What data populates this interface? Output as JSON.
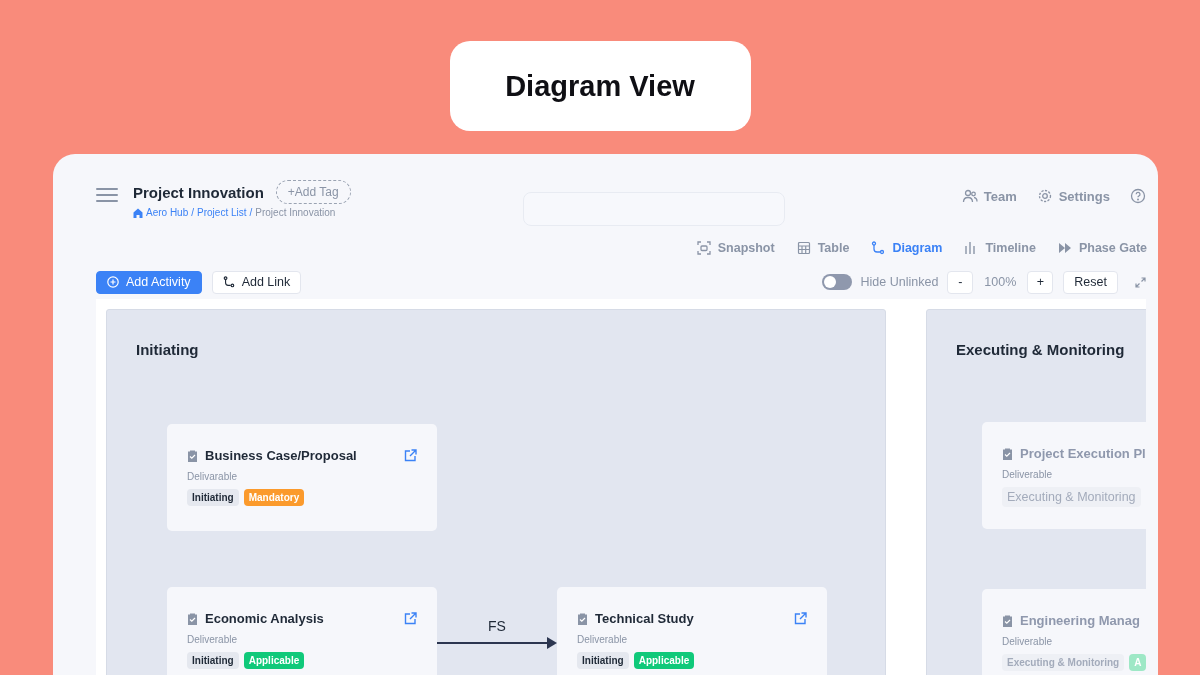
{
  "banner": {
    "title": "Diagram View"
  },
  "header": {
    "project_title": "Project Innovation",
    "add_tag": "+Add Tag",
    "breadcrumb": [
      {
        "label": "Aero Hub",
        "kind": "link"
      },
      {
        "label": "/",
        "kind": "sep"
      },
      {
        "label": "Project List",
        "kind": "link"
      },
      {
        "label": "/",
        "kind": "sep"
      },
      {
        "label": "Project Innovation",
        "kind": "current"
      }
    ],
    "top_links": [
      {
        "label": "Team",
        "kind": "team"
      },
      {
        "label": "Settings",
        "kind": "settings"
      },
      {
        "kind": "help"
      }
    ]
  },
  "view_tabs": [
    {
      "label": "Snapshot",
      "kind": "snapshot",
      "selected": false
    },
    {
      "label": "Table",
      "kind": "table",
      "selected": false
    },
    {
      "label": "Diagram",
      "kind": "diagram",
      "selected": true
    },
    {
      "label": "Timeline",
      "kind": "timeline",
      "selected": false
    },
    {
      "label": "Phase Gate",
      "kind": "phasegate",
      "selected": false
    }
  ],
  "toolbar": {
    "add_activity": "Add Activity",
    "add_link": "Add Link",
    "hide_unlinked": {
      "label": "Hide Unlinked",
      "on": false
    },
    "zoom_out": "-",
    "zoom_level": "100%",
    "zoom_in": "+",
    "reset": "Reset"
  },
  "phases": [
    {
      "title": "Initiating",
      "cards": [
        {
          "title": "Business Case/Proposal",
          "type": "Delivarable",
          "dimmed": false,
          "tags": [
            {
              "label": "Initiating",
              "kind": "phase"
            },
            {
              "label": "Mandatory",
              "kind": "mandatory"
            }
          ]
        },
        {
          "title": "Economic Analysis",
          "type": "Deliverable",
          "dimmed": false,
          "tags": [
            {
              "label": "Initiating",
              "kind": "phase"
            },
            {
              "label": "Applicable",
              "kind": "applicable"
            }
          ]
        },
        {
          "title": "Technical Study",
          "type": "Deliverable",
          "dimmed": false,
          "tags": [
            {
              "label": "Initiating",
              "kind": "phase"
            },
            {
              "label": "Applicable",
              "kind": "applicable"
            }
          ]
        }
      ],
      "links": [
        {
          "label": "FS"
        }
      ]
    },
    {
      "title": "Executing & Monitoring",
      "cards": [
        {
          "title": "Project Execution Pl",
          "type": "Deliverable",
          "dimmed": true,
          "tags": [
            {
              "label": "Executing & Monitoring",
              "kind": "phase"
            }
          ]
        },
        {
          "title": "Engineering Manag",
          "type": "Deliverable",
          "dimmed": true,
          "tags": [
            {
              "label": "Executing & Monitoring",
              "kind": "phase"
            },
            {
              "label": "A",
              "kind": "applicable"
            }
          ]
        }
      ]
    }
  ]
}
